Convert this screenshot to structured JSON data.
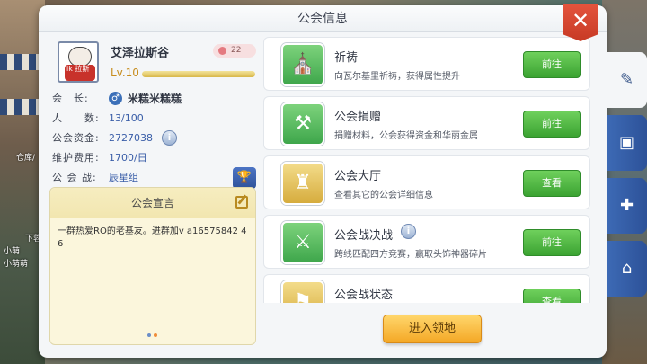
{
  "background": {
    "labels": [
      "仓库/",
      "下蓉",
      "小萌",
      "小萌萌"
    ]
  },
  "panel": {
    "title": "公会信息",
    "close_icon": "close-icon"
  },
  "guild": {
    "name": "艾泽拉斯谷",
    "avatar_text": "ik 拉斯",
    "member_count_badge": "22",
    "level": "Lv.10",
    "level_progress": 1.0,
    "fields": [
      {
        "key": "会　长:",
        "value": "米糕米糕糕"
      },
      {
        "key": "人　　数:",
        "value": "13/100"
      },
      {
        "key": "公会资金:",
        "value": "2727038"
      },
      {
        "key": "维护费用:",
        "value": "1700/日"
      },
      {
        "key": "公 会 战:",
        "value": "辰星组"
      }
    ]
  },
  "announcement": {
    "title": "公会宣言",
    "text": "一群热爱RO的老基友。进群加v a16575842 46"
  },
  "features": [
    {
      "title": "祈祷",
      "desc": "向瓦尔基里祈祷，获得属性提升",
      "button": "前往",
      "icon": "prayer-icon"
    },
    {
      "title": "公会捐赠",
      "desc": "捐赠材料，公会获得资金和华丽金属",
      "button": "前往",
      "icon": "donate-icon"
    },
    {
      "title": "公会大厅",
      "desc": "查看其它的公会详细信息",
      "button": "查看",
      "icon": "castle-icon"
    },
    {
      "title": "公会战决战",
      "desc": "跨线匹配四方竞赛，赢取头饰神器碎片",
      "button": "前往",
      "icon": "guild-war-icon"
    },
    {
      "title": "公会战状态",
      "desc": "",
      "button": "查看",
      "icon": "flag-icon"
    }
  ],
  "enter_button": "进入领地",
  "side_tabs": [
    "edit-tab-icon",
    "member-tab-icon",
    "plus-tab-icon",
    "home-tab-icon"
  ],
  "colors": {
    "accent_blue": "#3d6ab5",
    "button_green": "#4bb53e",
    "enter_orange": "#f4a826",
    "close_red": "#d9442e"
  }
}
